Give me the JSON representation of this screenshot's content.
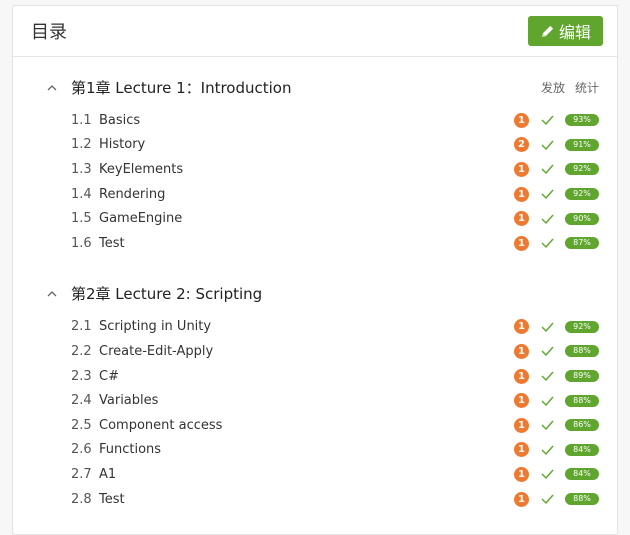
{
  "header": {
    "title": "目录",
    "edit_label": "编辑"
  },
  "columns": {
    "publish": "发放",
    "stats": "统计"
  },
  "colors": {
    "accent": "#5fa52e",
    "badge": "#ee7a32"
  },
  "chapters": [
    {
      "title": "第1章 Lecture 1：Introduction",
      "lessons": [
        {
          "num": "1.1",
          "name": "Basics",
          "count": "1",
          "pct": "93%"
        },
        {
          "num": "1.2",
          "name": "History",
          "count": "2",
          "pct": "91%"
        },
        {
          "num": "1.3",
          "name": "KeyElements",
          "count": "1",
          "pct": "92%"
        },
        {
          "num": "1.4",
          "name": "Rendering",
          "count": "1",
          "pct": "92%"
        },
        {
          "num": "1.5",
          "name": "GameEngine",
          "count": "1",
          "pct": "90%"
        },
        {
          "num": "1.6",
          "name": "Test",
          "count": "1",
          "pct": "87%"
        }
      ]
    },
    {
      "title": "第2章 Lecture 2: Scripting",
      "lessons": [
        {
          "num": "2.1",
          "name": "Scripting in Unity",
          "count": "1",
          "pct": "92%"
        },
        {
          "num": "2.2",
          "name": "Create-Edit-Apply",
          "count": "1",
          "pct": "88%"
        },
        {
          "num": "2.3",
          "name": "C#",
          "count": "1",
          "pct": "89%"
        },
        {
          "num": "2.4",
          "name": "Variables",
          "count": "1",
          "pct": "88%"
        },
        {
          "num": "2.5",
          "name": "Component access",
          "count": "1",
          "pct": "86%"
        },
        {
          "num": "2.6",
          "name": "Functions",
          "count": "1",
          "pct": "84%"
        },
        {
          "num": "2.7",
          "name": "A1",
          "count": "1",
          "pct": "84%"
        },
        {
          "num": "2.8",
          "name": "Test",
          "count": "1",
          "pct": "88%"
        }
      ]
    }
  ]
}
